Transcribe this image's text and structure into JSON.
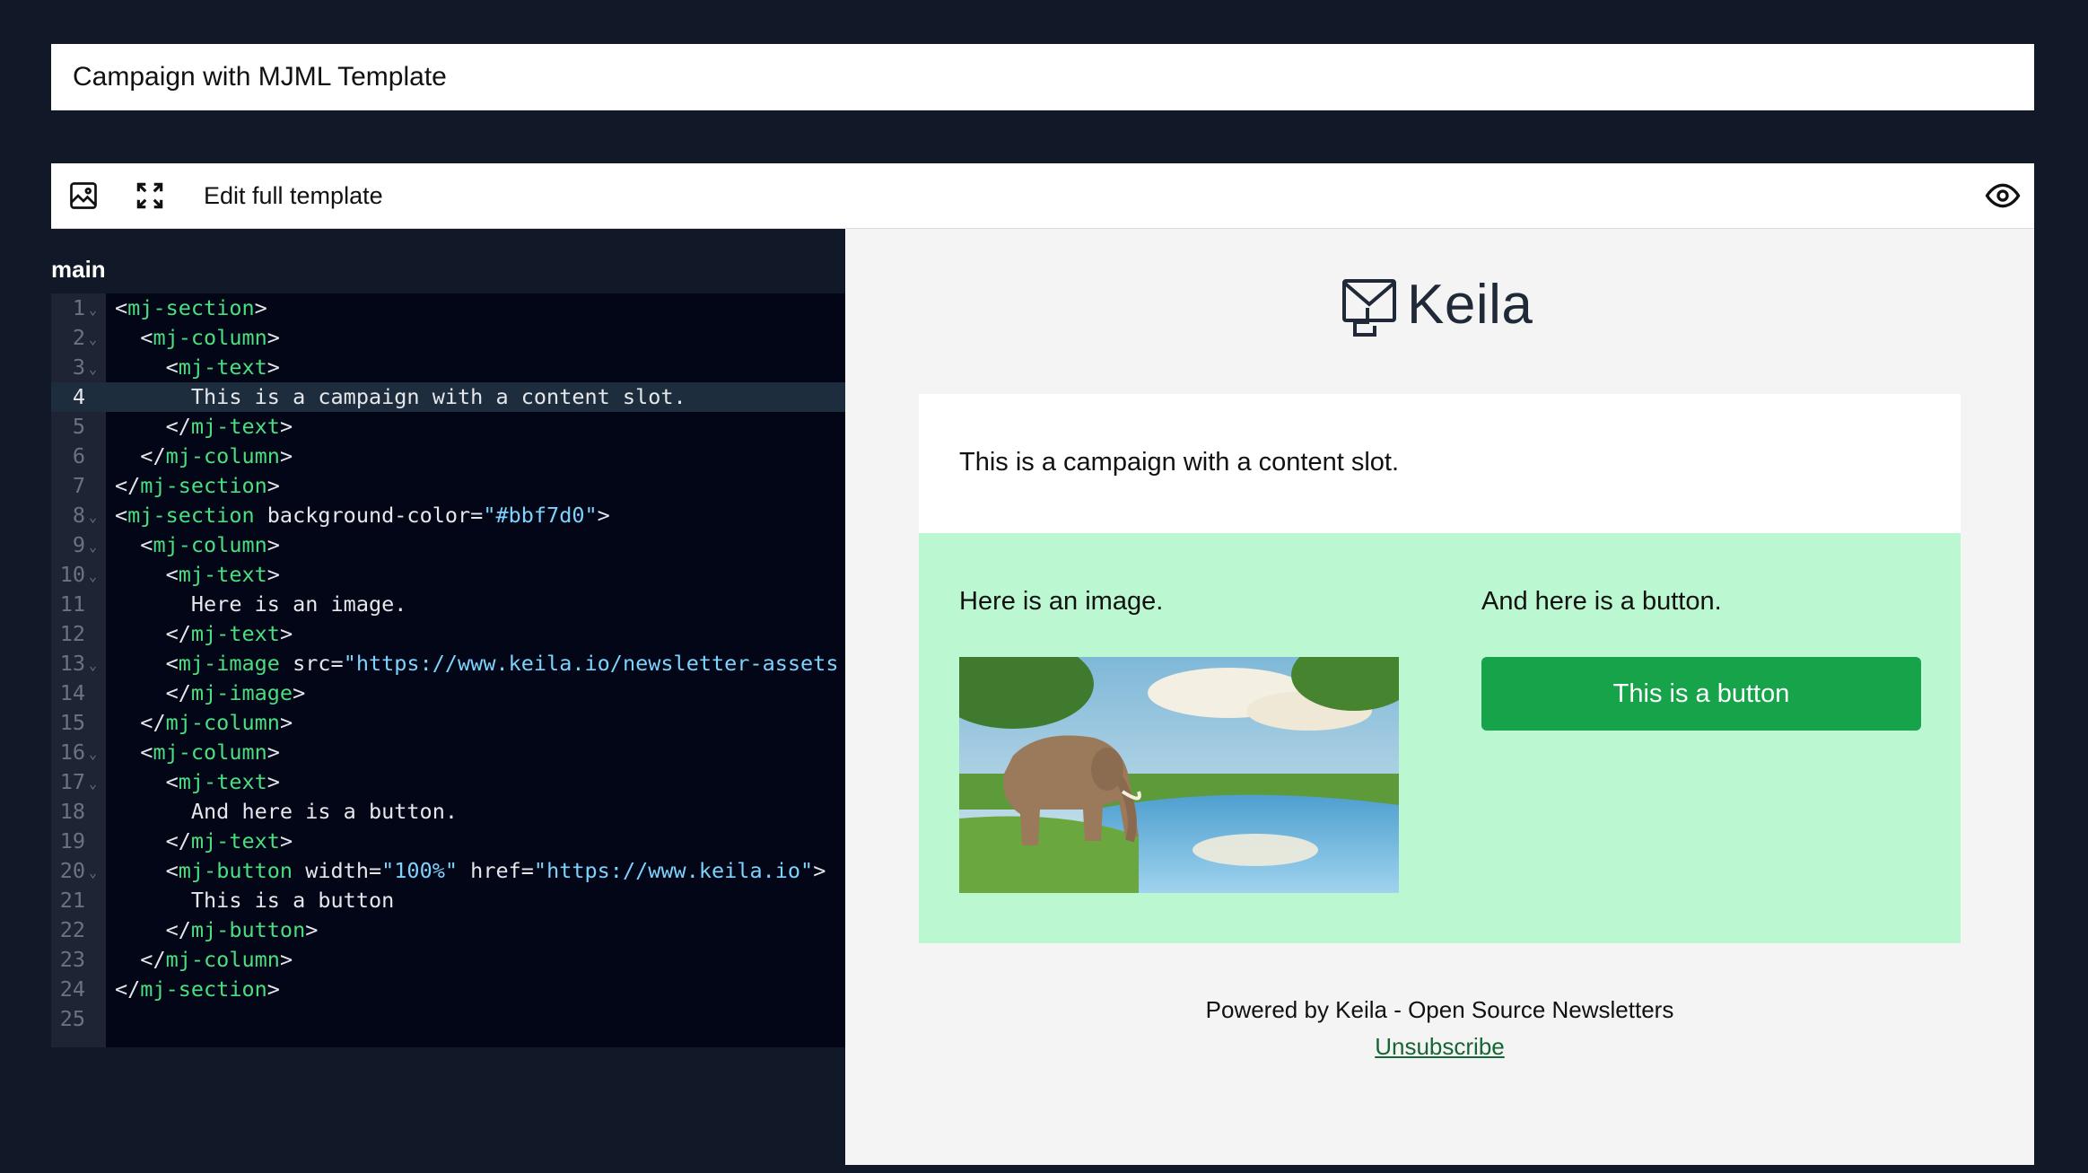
{
  "campaign": {
    "title": "Campaign with MJML Template"
  },
  "toolbar": {
    "image_icon": "image-icon",
    "fullscreen_icon": "fullscreen-icon",
    "edit_full_template_label": "Edit full template",
    "preview_icon": "eye-icon"
  },
  "editor": {
    "block_label": "main",
    "lines": [
      "1",
      "2",
      "3",
      "4",
      "5",
      "6",
      "7",
      "8",
      "9",
      "10",
      "11",
      "12",
      "13",
      "14",
      "15",
      "16",
      "17",
      "18",
      "19",
      "20",
      "21",
      "22",
      "23",
      "24",
      "25"
    ],
    "active_line": 4,
    "code": {
      "tag_mj_section": "mj-section",
      "tag_mj_column": "mj-column",
      "tag_mj_text": "mj-text",
      "tag_mj_image": "mj-image",
      "tag_mj_button": "mj-button",
      "text1": "This is a campaign with a content slot.",
      "attr_bg": " background-color=",
      "val_bg": "\"#bbf7d0\"",
      "text2": "Here is an image.",
      "attr_src": " src=",
      "val_src": "\"https://www.keila.io/newsletter-assets",
      "text3": "And here is a button.",
      "attr_width": " width=",
      "val_width": "\"100%\"",
      "attr_href": " href=",
      "val_href": "\"https://www.keila.io\"",
      "text4": "This is a button"
    }
  },
  "preview": {
    "logo_text": "Keila",
    "content_text": "This is a campaign with a content slot.",
    "section_bg": "#bbf7d0",
    "image_caption": "Here is an image.",
    "button_caption": "And here is a button.",
    "button_label": "This is a button",
    "button_color": "#16a34a",
    "footer_text": "Powered by Keila - Open Source Newsletters",
    "unsubscribe": "Unsubscribe"
  }
}
